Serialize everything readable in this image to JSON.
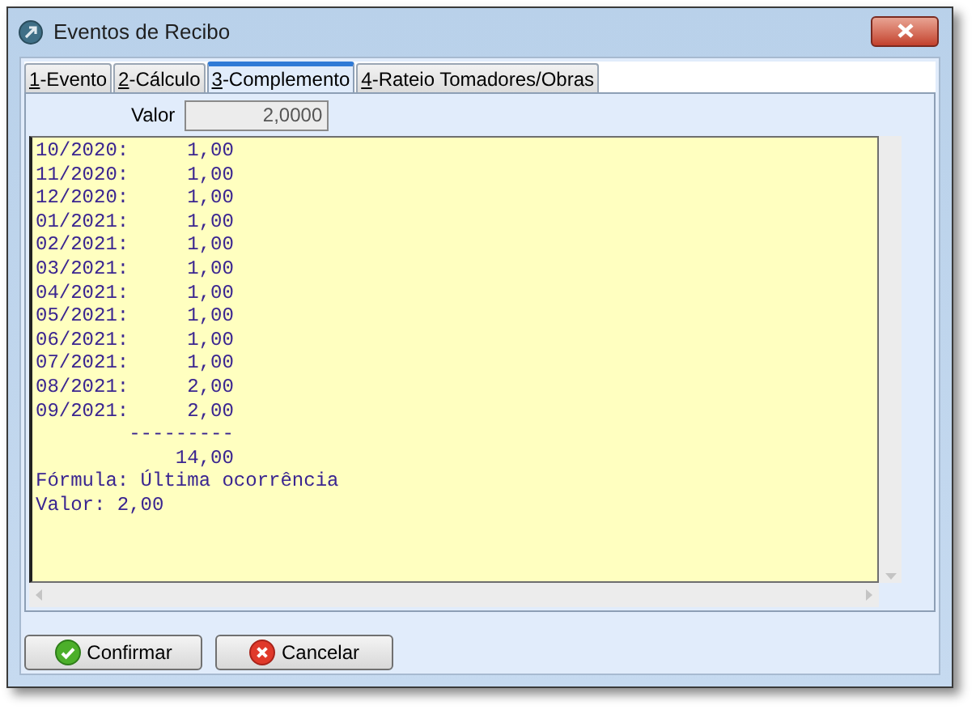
{
  "window": {
    "title": "Eventos de Recibo"
  },
  "tabs": [
    {
      "label": "1-Evento",
      "selected": false
    },
    {
      "label": "2-Cálculo",
      "selected": false
    },
    {
      "label": "3-Complemento",
      "selected": true
    },
    {
      "label": "4-Rateio Tomadores/Obras",
      "selected": false
    }
  ],
  "valor_field": {
    "label": "Valor",
    "value": "2,0000"
  },
  "memo_lines": [
    "10/2020:     1,00",
    "11/2020:     1,00",
    "12/2020:     1,00",
    "01/2021:     1,00",
    "02/2021:     1,00",
    "03/2021:     1,00",
    "04/2021:     1,00",
    "05/2021:     1,00",
    "06/2021:     1,00",
    "07/2021:     1,00",
    "08/2021:     2,00",
    "09/2021:     2,00",
    "        ---------",
    "            14,00",
    "Fórmula: Última ocorrência",
    "Valor: 2,00"
  ],
  "buttons": [
    {
      "label": "Confirmar",
      "kind": "confirm"
    },
    {
      "label": "Cancelar",
      "kind": "cancel"
    }
  ]
}
